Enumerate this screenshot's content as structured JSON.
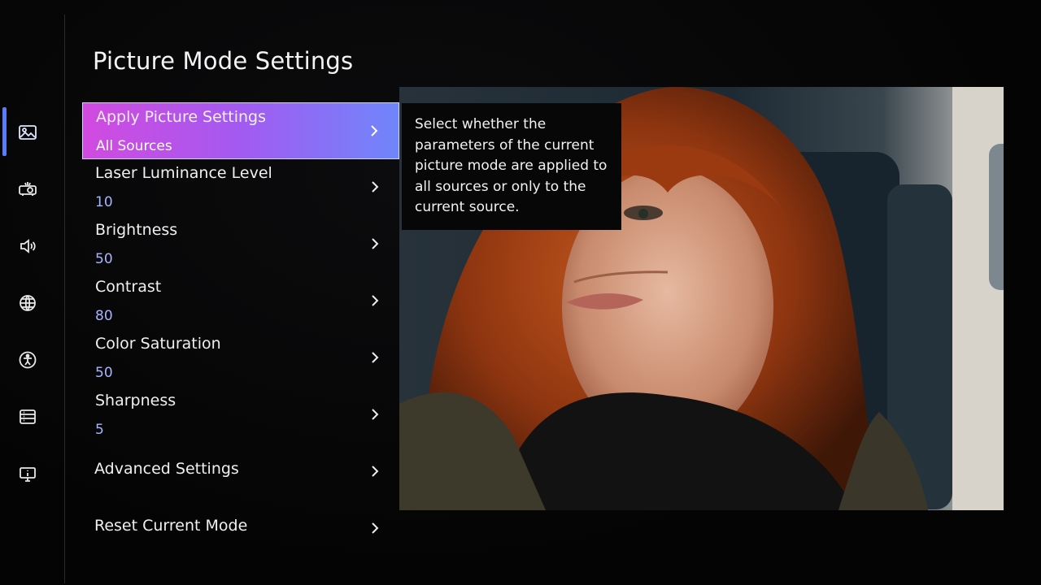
{
  "page": {
    "title": "Picture Mode Settings"
  },
  "rail": {
    "items": [
      {
        "icon": "picture-icon",
        "active": true
      },
      {
        "icon": "projector-icon",
        "active": false
      },
      {
        "icon": "speaker-icon",
        "active": false
      },
      {
        "icon": "globe-icon",
        "active": false
      },
      {
        "icon": "accessibility-icon",
        "active": false
      },
      {
        "icon": "list-icon",
        "active": false
      },
      {
        "icon": "info-display-icon",
        "active": false
      }
    ],
    "accent_color": "#5b7cfa"
  },
  "menu": {
    "items": [
      {
        "label": "Apply Picture Settings",
        "value": "All Sources",
        "selected": true
      },
      {
        "label": "Laser Luminance Level",
        "value": "10"
      },
      {
        "label": "Brightness",
        "value": "50"
      },
      {
        "label": "Contrast",
        "value": "80"
      },
      {
        "label": "Color Saturation",
        "value": "50"
      },
      {
        "label": "Sharpness",
        "value": "5"
      }
    ],
    "advanced_label": "Advanced Settings",
    "reset_label": "Reset Current Mode",
    "selected_gradient": [
      "#d24ae0",
      "#a35af0",
      "#6f86fb"
    ],
    "value_color": "#a9b4ff"
  },
  "help": {
    "lines": [
      "Select whether the",
      "parameters of the current",
      "picture mode are applied to",
      "all sources or only to the",
      "current source."
    ]
  }
}
